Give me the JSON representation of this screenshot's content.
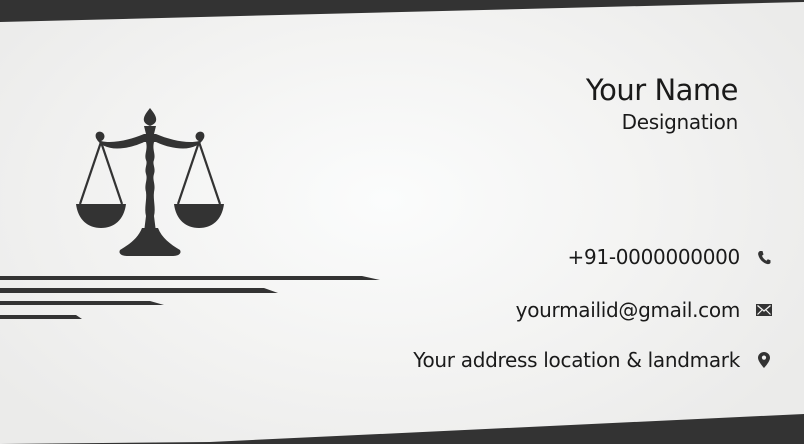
{
  "card": {
    "name": "Your Name",
    "designation": "Designation",
    "phone": "+91-0000000000",
    "email": "yourmailid@gmail.com",
    "address": "Your address location & landmark"
  },
  "icons": {
    "logo": "scales-of-justice-icon",
    "phone": "phone-icon",
    "email": "envelope-icon",
    "address": "map-pin-icon"
  },
  "colors": {
    "dark": "#333333",
    "background": "#f3f3f2",
    "text": "#1a1a1a"
  }
}
